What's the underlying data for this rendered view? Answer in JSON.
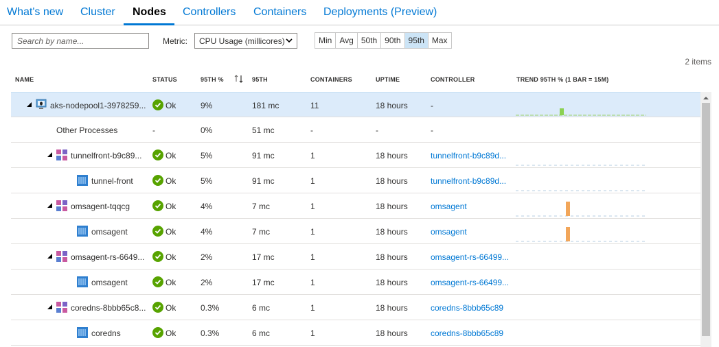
{
  "tabs": [
    {
      "label": "What's new"
    },
    {
      "label": "Cluster"
    },
    {
      "label": "Nodes"
    },
    {
      "label": "Controllers"
    },
    {
      "label": "Containers"
    },
    {
      "label": "Deployments (Preview)"
    }
  ],
  "toolbar": {
    "search_placeholder": "Search by name...",
    "metric_label": "Metric:",
    "metric_value": "CPU Usage (millicores)",
    "percentiles": [
      "Min",
      "Avg",
      "50th",
      "90th",
      "95th",
      "Max"
    ],
    "selected_percentile": "95th"
  },
  "items_count": "2 items",
  "columns": {
    "name": "NAME",
    "status": "STATUS",
    "p95pct": "95TH %",
    "p95": "95TH",
    "containers": "CONTAINERS",
    "uptime": "UPTIME",
    "controller": "CONTROLLER",
    "trend": "TREND 95TH % (1 BAR = 15M)"
  },
  "rows": [
    {
      "name": "aks-nodepool1-3978259...",
      "status": "Ok",
      "pct": "9%",
      "value": "181 mc",
      "containers": "11",
      "uptime": "18 hours",
      "controller": "-"
    },
    {
      "name": "Other Processes",
      "status": "-",
      "pct": "0%",
      "value": "51 mc",
      "containers": "-",
      "uptime": "-",
      "controller": "-"
    },
    {
      "name": "tunnelfront-b9c89...",
      "status": "Ok",
      "pct": "5%",
      "value": "91 mc",
      "containers": "1",
      "uptime": "18 hours",
      "controller": "tunnelfront-b9c89d..."
    },
    {
      "name": "tunnel-front",
      "status": "Ok",
      "pct": "5%",
      "value": "91 mc",
      "containers": "1",
      "uptime": "18 hours",
      "controller": "tunnelfront-b9c89d..."
    },
    {
      "name": "omsagent-tqqcg",
      "status": "Ok",
      "pct": "4%",
      "value": "7 mc",
      "containers": "1",
      "uptime": "18 hours",
      "controller": "omsagent"
    },
    {
      "name": "omsagent",
      "status": "Ok",
      "pct": "4%",
      "value": "7 mc",
      "containers": "1",
      "uptime": "18 hours",
      "controller": "omsagent"
    },
    {
      "name": "omsagent-rs-6649...",
      "status": "Ok",
      "pct": "2%",
      "value": "17 mc",
      "containers": "1",
      "uptime": "18 hours",
      "controller": "omsagent-rs-66499..."
    },
    {
      "name": "omsagent",
      "status": "Ok",
      "pct": "2%",
      "value": "17 mc",
      "containers": "1",
      "uptime": "18 hours",
      "controller": "omsagent-rs-66499..."
    },
    {
      "name": "coredns-8bbb65c8...",
      "status": "Ok",
      "pct": "0.3%",
      "value": "6 mc",
      "containers": "1",
      "uptime": "18 hours",
      "controller": "coredns-8bbb65c89"
    },
    {
      "name": "coredns",
      "status": "Ok",
      "pct": "0.3%",
      "value": "6 mc",
      "containers": "1",
      "uptime": "18 hours",
      "controller": "coredns-8bbb65c89"
    }
  ],
  "colors": {
    "accent": "#0078d4",
    "ok": "#57a300",
    "spark_green": "#8bd152",
    "spark_orange": "#f2a65a",
    "spark_base_green": "#9bd067",
    "spark_base_blue": "#b6cde2"
  }
}
